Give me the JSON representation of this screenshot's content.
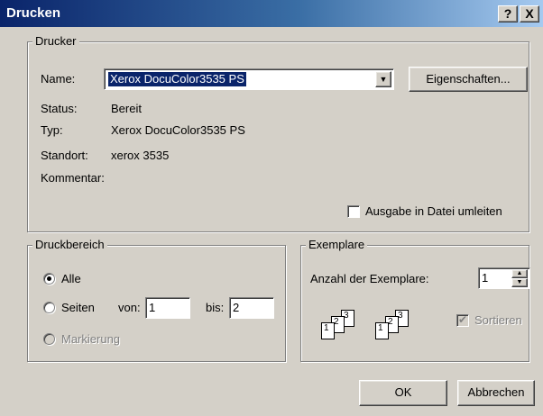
{
  "window": {
    "title": "Drucken",
    "help_btn": "?",
    "close_btn": "X"
  },
  "printer": {
    "group_label": "Drucker",
    "name_label": "Name:",
    "name_value": "Xerox DocuColor3535 PS",
    "properties_button": "Eigenschaften...",
    "status_label": "Status:",
    "status_value": "Bereit",
    "type_label": "Typ:",
    "type_value": "Xerox DocuColor3535 PS",
    "location_label": "Standort:",
    "location_value": "xerox 3535",
    "comment_label": "Kommentar:",
    "print_to_file": "Ausgabe in Datei umleiten"
  },
  "range": {
    "group_label": "Druckbereich",
    "all": "Alle",
    "pages": "Seiten",
    "from_label": "von:",
    "from_value": "1",
    "to_label": "bis:",
    "to_value": "2",
    "selection": "Markierung"
  },
  "copies": {
    "group_label": "Exemplare",
    "count_label": "Anzahl der Exemplare:",
    "count_value": "1",
    "collate": "Sortieren"
  },
  "buttons": {
    "ok": "OK",
    "cancel": "Abbrechen"
  }
}
